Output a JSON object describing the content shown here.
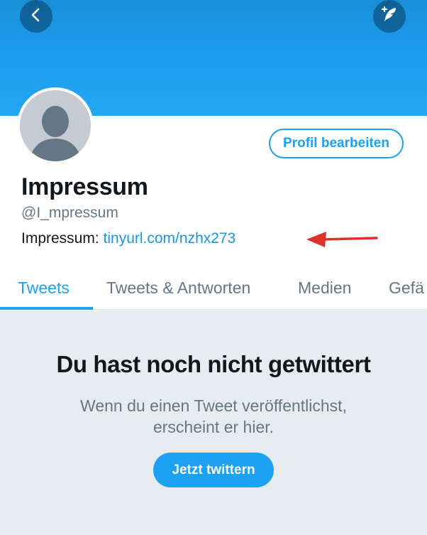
{
  "header": {
    "back_icon": "chevron-left-icon",
    "compose_icon": "feather-plus-icon"
  },
  "profile": {
    "display_name": "Impressum",
    "handle": "@I_mpressum",
    "bio_prefix": "Impressum: ",
    "bio_link": "tinyurl.com/nzhx273",
    "edit_button": "Profil bearbeiten",
    "avatar_icon": "default-avatar-icon",
    "annotation_icon": "red-arrow-left-icon"
  },
  "tabs": [
    {
      "label": "Tweets",
      "active": true
    },
    {
      "label": "Tweets & Antworten",
      "active": false
    },
    {
      "label": "Medien",
      "active": false
    },
    {
      "label": "Gefä",
      "active": false
    }
  ],
  "empty_state": {
    "title": "Du hast noch nicht getwittert",
    "text_line1": "Wenn du einen Tweet veröffentlichst,",
    "text_line2": "erscheint er hier.",
    "button": "Jetzt twittern"
  },
  "colors": {
    "accent": "#1da1f2",
    "link": "#1b95e0",
    "annotation_red": "#e0302a",
    "empty_bg": "#e6ecf0"
  }
}
